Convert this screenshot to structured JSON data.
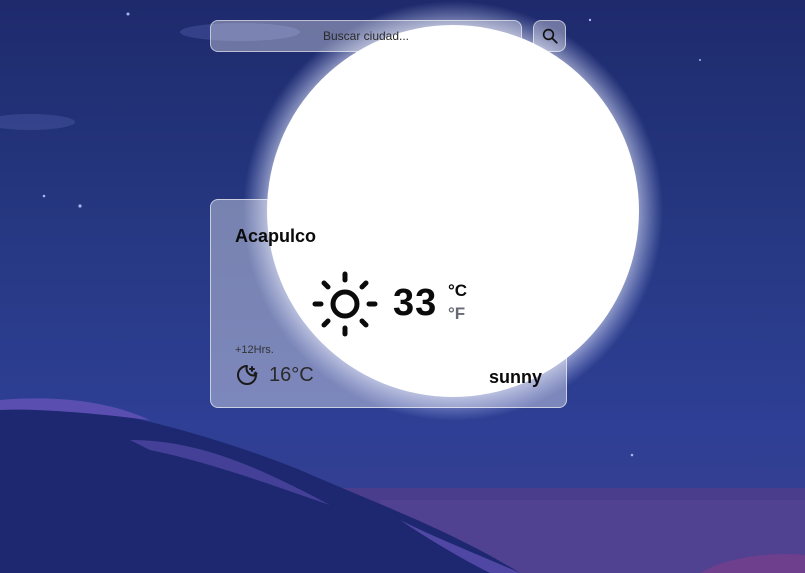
{
  "search": {
    "placeholder": "Buscar ciudad..."
  },
  "icons": {
    "search": "search-icon",
    "current_weather": "sun-icon",
    "forecast_weather": "moon-stars-icon"
  },
  "weather": {
    "city": "Acapulco",
    "temperature": "33",
    "unit_celsius": "°C",
    "unit_fahrenheit": "°F",
    "forecast_label": "+12Hrs.",
    "forecast_temp": "16°C",
    "condition": "sunny"
  },
  "colors": {
    "sky_top": "#1e2a6c",
    "sky_bottom": "#2e3f95",
    "moon": "#ffffff",
    "inactive_unit": "#666a75"
  }
}
